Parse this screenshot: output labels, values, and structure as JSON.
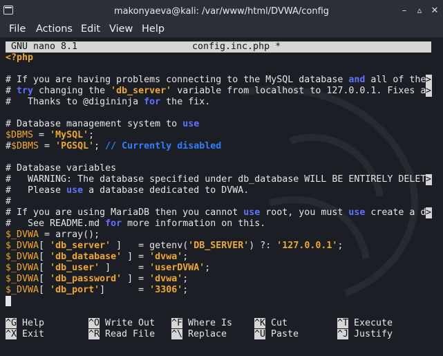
{
  "window": {
    "title": "makonyaeva@kali: /var/www/html/DVWA/config",
    "buttons": [
      "minimize-icon",
      "maximize-icon",
      "close-icon"
    ]
  },
  "menu": [
    "File",
    "Actions",
    "Edit",
    "View",
    "Help"
  ],
  "nano": {
    "version": "GNU nano 8.1",
    "filename": "config.inc.php *"
  },
  "file_lines": [
    [
      {
        "t": "<?php",
        "c": "tag"
      }
    ],
    [],
    [
      {
        "t": "# If you are having problems connecting to the MySQL database ",
        "c": "txt"
      },
      {
        "t": "and",
        "c": "kw"
      },
      {
        "t": " all of the",
        "c": "txt"
      }
    ],
    [
      {
        "t": "# ",
        "c": "txt"
      },
      {
        "t": "try",
        "c": "kw"
      },
      {
        "t": " changing the ",
        "c": "txt"
      },
      {
        "t": "'db_server'",
        "c": "str"
      },
      {
        "t": " variable from localhost to 127.0.0.1. Fixes a",
        "c": "txt"
      }
    ],
    [
      {
        "t": "#   Thanks to @digininja ",
        "c": "txt"
      },
      {
        "t": "for",
        "c": "kw"
      },
      {
        "t": " the fix.",
        "c": "txt"
      }
    ],
    [],
    [
      {
        "t": "# Database management system to ",
        "c": "txt"
      },
      {
        "t": "use",
        "c": "kw"
      }
    ],
    [
      {
        "t": "$DBMS",
        "c": "var"
      },
      {
        "t": " = ",
        "c": "txt"
      },
      {
        "t": "'MySQL'",
        "c": "str"
      },
      {
        "t": ";",
        "c": "txt"
      }
    ],
    [
      {
        "t": "#",
        "c": "txt"
      },
      {
        "t": "$DBMS",
        "c": "var"
      },
      {
        "t": " = ",
        "c": "txt"
      },
      {
        "t": "'PGSQL'",
        "c": "str"
      },
      {
        "t": "; ",
        "c": "txt"
      },
      {
        "t": "// Currently disabled",
        "c": "cm"
      }
    ],
    [],
    [
      {
        "t": "# Database variables",
        "c": "txt"
      }
    ],
    [
      {
        "t": "#   WARNING: The database specified under db_database WILL BE ENTIRELY DELET",
        "c": "txt"
      }
    ],
    [
      {
        "t": "#   Please ",
        "c": "txt"
      },
      {
        "t": "use",
        "c": "kw"
      },
      {
        "t": " a database dedicated to DVWA.",
        "c": "txt"
      }
    ],
    [
      {
        "t": "#",
        "c": "txt"
      }
    ],
    [
      {
        "t": "# If you are using MariaDB then you cannot ",
        "c": "txt"
      },
      {
        "t": "use",
        "c": "kw"
      },
      {
        "t": " root, you must ",
        "c": "txt"
      },
      {
        "t": "use",
        "c": "kw"
      },
      {
        "t": " create a d",
        "c": "txt"
      }
    ],
    [
      {
        "t": "#   See README.md ",
        "c": "txt"
      },
      {
        "t": "for",
        "c": "kw"
      },
      {
        "t": " more information on this.",
        "c": "txt"
      }
    ],
    [
      {
        "t": "$_DVWA",
        "c": "var"
      },
      {
        "t": " = array();",
        "c": "txt"
      }
    ],
    [
      {
        "t": "$_DVWA",
        "c": "var"
      },
      {
        "t": "[ ",
        "c": "txt"
      },
      {
        "t": "'db_server'",
        "c": "str"
      },
      {
        "t": " ]   = getenv(",
        "c": "txt"
      },
      {
        "t": "'DB_SERVER'",
        "c": "str"
      },
      {
        "t": ") ?: ",
        "c": "txt"
      },
      {
        "t": "'127.0.0.1'",
        "c": "str"
      },
      {
        "t": ";",
        "c": "txt"
      }
    ],
    [
      {
        "t": "$_DVWA",
        "c": "var"
      },
      {
        "t": "[ ",
        "c": "txt"
      },
      {
        "t": "'db_database'",
        "c": "str"
      },
      {
        "t": " ] = ",
        "c": "txt"
      },
      {
        "t": "'dvwa'",
        "c": "str"
      },
      {
        "t": ";",
        "c": "txt"
      }
    ],
    [
      {
        "t": "$_DVWA",
        "c": "var"
      },
      {
        "t": "[ ",
        "c": "txt"
      },
      {
        "t": "'db_user'",
        "c": "str"
      },
      {
        "t": " ]     = ",
        "c": "txt"
      },
      {
        "t": "'userDVWA'",
        "c": "str"
      },
      {
        "t": ";",
        "c": "txt"
      }
    ],
    [
      {
        "t": "$_DVWA",
        "c": "var"
      },
      {
        "t": "[ ",
        "c": "txt"
      },
      {
        "t": "'db_password'",
        "c": "str"
      },
      {
        "t": " ] = ",
        "c": "txt"
      },
      {
        "t": "'dvwa'",
        "c": "str"
      },
      {
        "t": ";",
        "c": "txt"
      }
    ],
    [
      {
        "t": "$_DVWA",
        "c": "var"
      },
      {
        "t": "[ ",
        "c": "txt"
      },
      {
        "t": "'db_port'",
        "c": "str"
      },
      {
        "t": "]      = ",
        "c": "txt"
      },
      {
        "t": "'3306'",
        "c": "str"
      },
      {
        "t": ";",
        "c": "txt"
      }
    ]
  ],
  "overflow_lines": [
    2,
    3,
    11,
    14
  ],
  "overflow_marker": ">",
  "shortcuts": [
    [
      {
        "key": "^G",
        "label": "Help"
      },
      {
        "key": "^O",
        "label": "Write Out"
      },
      {
        "key": "^F",
        "label": "Where Is"
      },
      {
        "key": "^K",
        "label": "Cut"
      },
      {
        "key": "^T",
        "label": "Execute"
      }
    ],
    [
      {
        "key": "^X",
        "label": "Exit"
      },
      {
        "key": "^R",
        "label": "Read File"
      },
      {
        "key": "^\\",
        "label": "Replace"
      },
      {
        "key": "^U",
        "label": "Paste"
      },
      {
        "key": "^J",
        "label": "Justify"
      }
    ]
  ],
  "colors": {
    "keyword": "#6272ff",
    "string": "#f0a830",
    "comment": "#2f7fff",
    "text": "#e6e6e6",
    "background": "#1b1e24",
    "titlebar": "#2b2f37"
  }
}
